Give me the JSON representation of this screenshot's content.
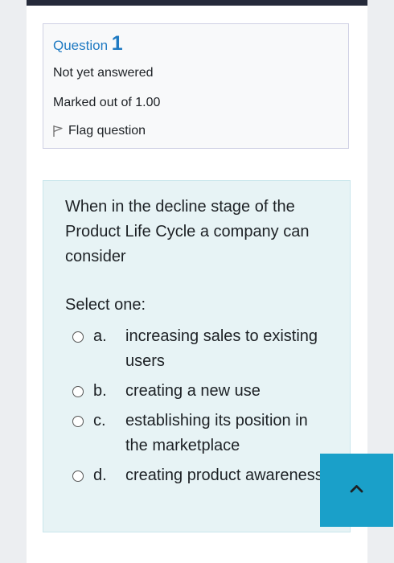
{
  "question": {
    "label": "Question",
    "number": "1",
    "state": "Not yet answered",
    "grade": "Marked out of 1.00",
    "flag_label": "Flag question"
  },
  "content": {
    "text": "When in the decline stage of the Product Life Cycle a company can consider",
    "prompt": "Select one:",
    "answers": [
      {
        "letter": "a.",
        "text": "increasing sales to existing users"
      },
      {
        "letter": "b.",
        "text": "creating a new use"
      },
      {
        "letter": "c.",
        "text": "establishing its position in the marketplace"
      },
      {
        "letter": "d.",
        "text": "creating product awareness"
      }
    ]
  },
  "icons": {
    "flag": "flag-icon",
    "back_to_top": "chevron-up-icon"
  },
  "colors": {
    "accent": "#1f7ac2",
    "top_bar": "#252a3a",
    "back_to_top": "#1aa0c9",
    "question_bg": "#e7f3f5"
  }
}
